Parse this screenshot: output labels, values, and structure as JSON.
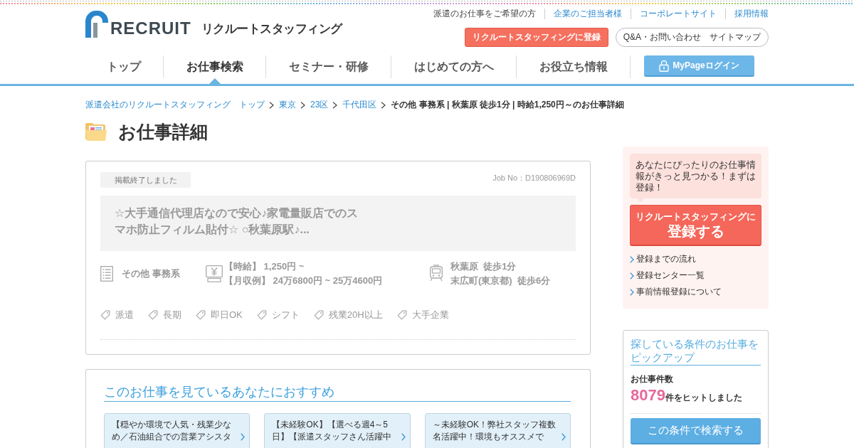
{
  "header": {
    "logo": {
      "wordmark": "RECRUIT",
      "company": "リクルートスタッフィング"
    },
    "top_links": [
      {
        "label": "派遣のお仕事をご希望の方",
        "selected": true
      },
      {
        "label": "企業のご担当者様",
        "selected": false
      },
      {
        "label": "コーポレートサイト",
        "selected": false
      },
      {
        "label": "採用情報",
        "selected": false
      }
    ],
    "register_button": "リクルートスタッフィングに登録",
    "help_links": [
      "Q&A・お問い合わせ",
      "サイトマップ"
    ],
    "nav": [
      {
        "label": "トップ",
        "selected": false
      },
      {
        "label": "お仕事検索",
        "selected": true
      },
      {
        "label": "セミナー・研修",
        "selected": false
      },
      {
        "label": "はじめての方へ",
        "selected": false
      },
      {
        "label": "お役立ち情報",
        "selected": false
      }
    ],
    "mypage_button": "MyPageログイン"
  },
  "breadcrumb": [
    {
      "label": "派遣会社のリクルートスタッフィング",
      "kind": "home"
    },
    {
      "label": "トップ",
      "kind": "link"
    },
    {
      "label": "東京",
      "kind": "link"
    },
    {
      "label": "23区",
      "kind": "link"
    },
    {
      "label": "千代田区",
      "kind": "link"
    },
    {
      "label": "その他 事務系 | 秋葉原 徒歩1分 | 時給1,250円～のお仕事詳細",
      "kind": "current"
    }
  ],
  "page_title": "お仕事詳細",
  "job": {
    "status_badge": "掲載終了しました",
    "job_no": "Job No：D190806969D",
    "title": "☆大手通信代理店なので安心♪家電量販店でのスマホ防止フィルム貼付☆ ○秋葉原駅♪...",
    "info": [
      {
        "kind": "category",
        "lines": [
          "その他 事務系"
        ]
      },
      {
        "kind": "salary",
        "lines": [
          "【時給】 1,250円 ~",
          "【月収例】 24万6800円 ~ 25万4600円"
        ]
      },
      {
        "kind": "station",
        "lines": [
          "秋葉原  徒歩1分",
          "末広町(東京都)  徒歩6分"
        ]
      }
    ],
    "tags": [
      "派遣",
      "長期",
      "即日OK",
      "シフト",
      "残業20H以上",
      "大手企業"
    ]
  },
  "recommend": {
    "title": "このお仕事を見ているあなたにおすすめ",
    "items": [
      "【穏やか環境で人気・残業少なめ／石油組合での営業アシスタ",
      "【未経験OK】【選べる週4～5日】【派遣スタッフさん活躍中",
      "～未経験OK！弊社スタッフ複数名活躍中！環境もオススメで"
    ]
  },
  "sidebar": {
    "register": {
      "message": "あなたにぴったりのお仕事情報がきっと見つかる！まずは登録！",
      "button_lead": "リクルートスタッフィングに",
      "button_main": "登録する",
      "links": [
        "登録までの流れ",
        "登録センター一覧",
        "事前情報登録について"
      ]
    },
    "pickup": {
      "title": "探している条件のお仕事をピックアップ",
      "count_label": "お仕事件数",
      "count": "8079",
      "count_suffix": "件をヒットしました",
      "search_button": "この条件で検索する"
    }
  }
}
